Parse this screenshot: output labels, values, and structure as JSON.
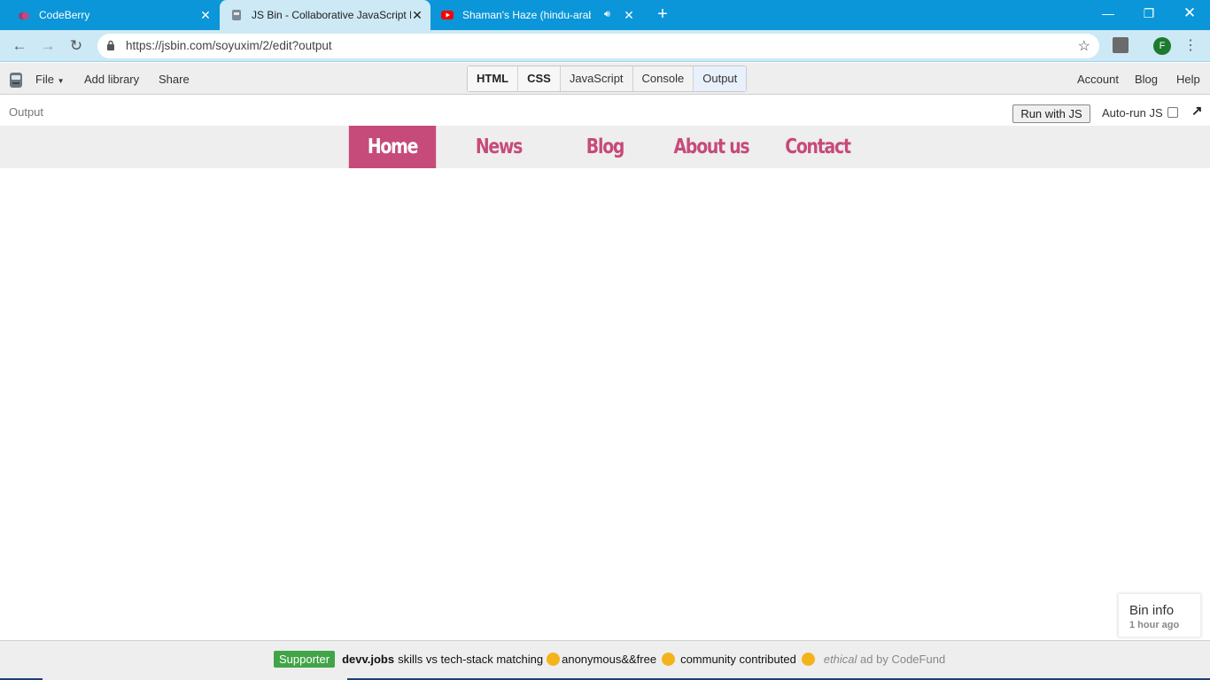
{
  "browser": {
    "tabs": [
      {
        "title": "CodeBerry",
        "favicon": "codeberry-icon"
      },
      {
        "title": "JS Bin - Collaborative JavaScript Debugging",
        "favicon": "jsbin-icon"
      },
      {
        "title": "Shaman's Haze (hindu-arab",
        "favicon": "youtube-icon",
        "audio": "speaker-icon"
      }
    ],
    "url": "https://jsbin.com/soyuxim/2/edit?output",
    "profile_initial": "F"
  },
  "jsbin": {
    "menu": {
      "file": "File",
      "add_library": "Add library",
      "share": "Share"
    },
    "panels": [
      "HTML",
      "CSS",
      "JavaScript",
      "Console",
      "Output"
    ],
    "right_links": [
      "Account",
      "Blog",
      "Help"
    ],
    "output_label": "Output",
    "run_button": "Run with JS",
    "autorun_label": "Auto-run JS"
  },
  "site": {
    "nav": [
      "Home",
      "News",
      "Blog",
      "About us",
      "Contact"
    ],
    "active": "Home",
    "accent": "#c64b7a"
  },
  "bin_info": {
    "title": "Bin info",
    "time": "1 hour ago"
  },
  "ad": {
    "badge": "Supporter",
    "brand": "devv.jobs",
    "text1": "skills vs tech-stack matching",
    "text2": "anonymous&&free",
    "text3": "community contributed",
    "ethical": "ethical",
    "credit": "ad by CodeFund"
  }
}
